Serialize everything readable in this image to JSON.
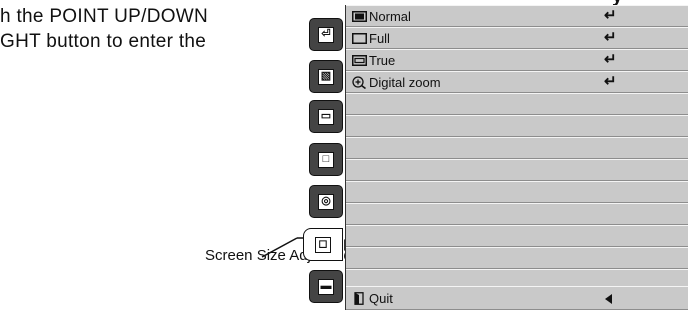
{
  "intro": {
    "line1": "h the POINT UP/DOWN",
    "line2": "GHT button to enter the",
    "heading_fragment": "y"
  },
  "callout": {
    "label": "Screen Size Adjustment menu"
  },
  "tabs": [
    {
      "name": "input-tab-icon",
      "glyph": "⏎"
    },
    {
      "name": "picture-tab-icon",
      "glyph": "▧"
    },
    {
      "name": "computer-tab-icon",
      "glyph": "▭"
    },
    {
      "name": "image-tab-icon",
      "glyph": "□"
    },
    {
      "name": "color-tab-icon",
      "glyph": "◎"
    },
    {
      "name": "screen-size-tab-icon",
      "glyph": "◻"
    },
    {
      "name": "setting-tab-icon",
      "glyph": "▬"
    }
  ],
  "menu": {
    "items": [
      {
        "label": "Normal",
        "icon": "normal-screen-icon",
        "action": "enter-icon"
      },
      {
        "label": "Full",
        "icon": "full-screen-icon",
        "action": "enter-icon"
      },
      {
        "label": "True",
        "icon": "true-screen-icon",
        "action": "enter-icon"
      },
      {
        "label": "Digital zoom",
        "icon": "digital-zoom-icon",
        "action": "enter-icon"
      }
    ],
    "quit": {
      "label": "Quit",
      "icon": "quit-icon",
      "action": "back-arrow-icon"
    }
  },
  "colors": {
    "menu_row": "#c9c9c9",
    "tab_dark": "#444444",
    "tab_active": "#ffffff"
  }
}
